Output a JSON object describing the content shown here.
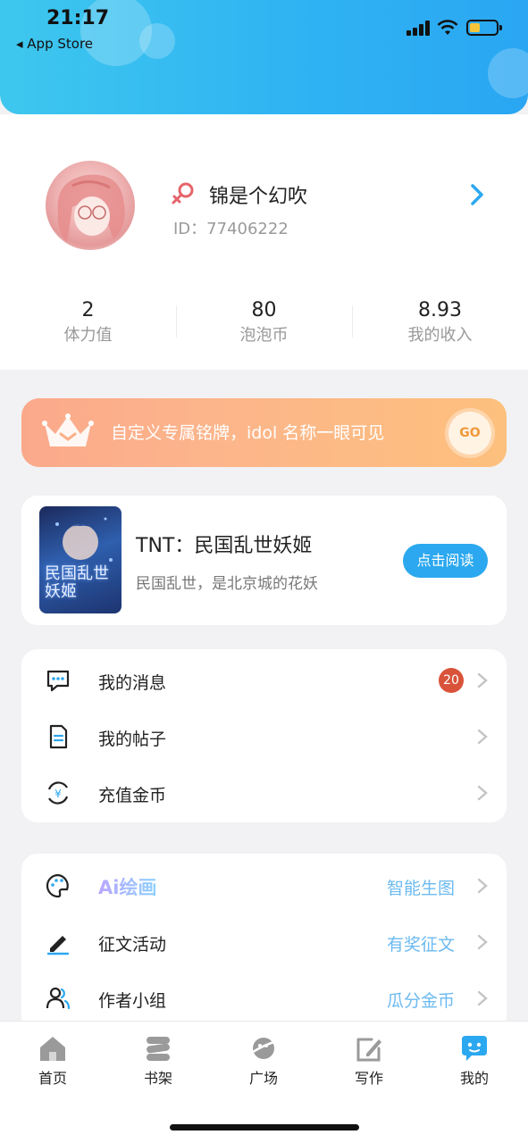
{
  "status_bar": {
    "time": "21:17",
    "back_label": "◂ App Store"
  },
  "profile": {
    "username": "锦是个幻吹",
    "user_id": "ID：77406222",
    "stats": [
      {
        "value": "2",
        "label": "体力值"
      },
      {
        "value": "80",
        "label": "泡泡币"
      },
      {
        "value": "8.93",
        "label": "我的收入"
      }
    ]
  },
  "vip_banner": {
    "text": "自定义专属铭牌，idol 名称一眼可见",
    "go_label": "GO"
  },
  "book": {
    "cover_text": "民国乱世妖姬",
    "title": "TNT：民国乱世妖姬",
    "description": "民国乱世，是北京城的花妖",
    "read_button": "点击阅读"
  },
  "menu_primary": [
    {
      "label": "我的消息",
      "icon": "message-icon",
      "badge": "20"
    },
    {
      "label": "我的帖子",
      "icon": "document-icon"
    },
    {
      "label": "充值金币",
      "icon": "coin-recharge-icon"
    }
  ],
  "menu_secondary": [
    {
      "label": "Ai绘画",
      "icon": "palette-icon",
      "right_text": "智能生图"
    },
    {
      "label": "征文活动",
      "icon": "pen-icon",
      "right_text": "有奖征文"
    },
    {
      "label": "作者小组",
      "icon": "group-icon",
      "right_text": "瓜分金币"
    }
  ],
  "tabbar": [
    {
      "label": "首页",
      "icon": "home-icon"
    },
    {
      "label": "书架",
      "icon": "bookshelf-icon"
    },
    {
      "label": "广场",
      "icon": "planet-icon"
    },
    {
      "label": "写作",
      "icon": "write-icon"
    },
    {
      "label": "我的",
      "icon": "profile-chat-icon",
      "active": true
    }
  ],
  "colors": {
    "header_gradient_start": "#3ec7ee",
    "header_gradient_end": "#2aa6f2",
    "accent_blue": "#2ba8ef",
    "badge_red": "#d9533a",
    "banner_orange": "#fcb58b"
  }
}
